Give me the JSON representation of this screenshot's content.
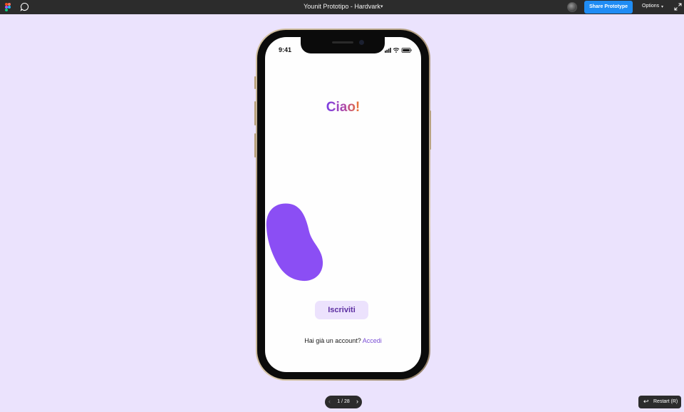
{
  "topbar": {
    "title": "Younit Prototipo - Hardvark",
    "share_label": "Share Prototype",
    "options_label": "Options"
  },
  "colors": {
    "background": "#ebe3fd",
    "share_button": "#1f8cf4",
    "blob": "#8b4ef4",
    "signup_bg": "#ece2fd",
    "link": "#7a4ed6"
  },
  "phone": {
    "status_time": "9:41",
    "greeting": "Ciao!",
    "signup_label": "Iscriviti",
    "login_prompt": "Hai già un account?",
    "login_link": "Accedi"
  },
  "footer": {
    "pager_text": "1 / 28",
    "restart_label": "Restart (R)"
  },
  "icons": [
    "figma-logo-icon",
    "comment-icon",
    "chevron-down-icon",
    "avatar",
    "expand-icon",
    "signal-icon",
    "wifi-icon",
    "battery-icon",
    "chevron-left-icon",
    "chevron-right-icon",
    "restart-icon"
  ]
}
